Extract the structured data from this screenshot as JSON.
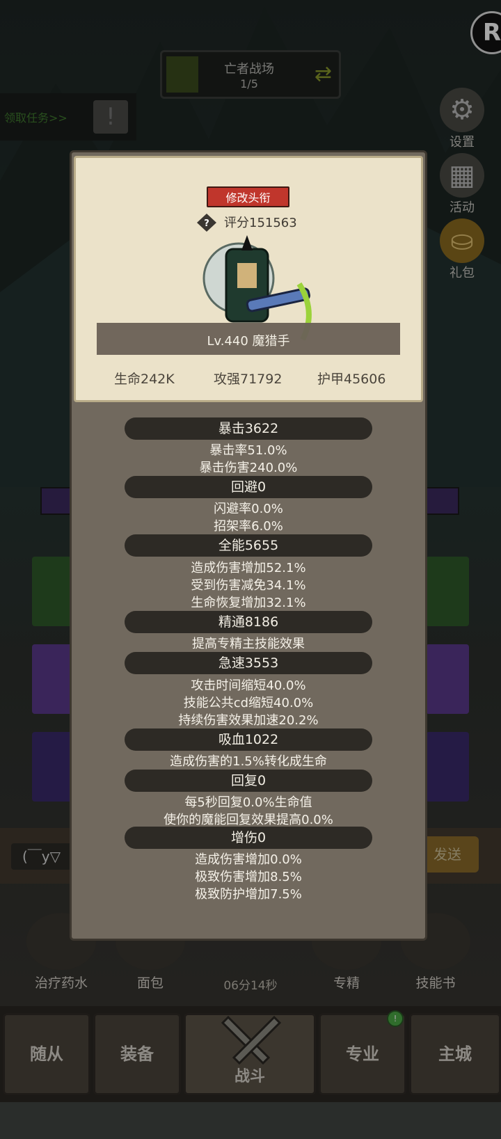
{
  "top": {
    "stage_name": "亡者战场",
    "stage_progress": "1/5"
  },
  "task": {
    "label": "领取任务>>",
    "icon": "exclamation-icon"
  },
  "side_buttons": [
    {
      "label": "设置",
      "icon": "gear-icon"
    },
    {
      "label": "活动",
      "icon": "calendar-icon"
    },
    {
      "label": "礼包",
      "icon": "gift-icon"
    }
  ],
  "panel": {
    "title_button": "修改头衔",
    "score": "评分151563",
    "hero_name": "Lv.440 魔猎手",
    "base_stats": [
      "生命242K",
      "攻强71792",
      "护甲45606"
    ],
    "stats": [
      {
        "header": "暴击3622",
        "lines": [
          "暴击率51.0%",
          "暴击伤害240.0%"
        ]
      },
      {
        "header": "回避0",
        "lines": [
          "闪避率0.0%",
          "招架率6.0%"
        ]
      },
      {
        "header": "全能5655",
        "lines": [
          "造成伤害增加52.1%",
          "受到伤害减免34.1%",
          "生命恢复增加32.1%"
        ]
      },
      {
        "header": "精通8186",
        "lines": [
          "提高专精主技能效果"
        ]
      },
      {
        "header": "急速3553",
        "lines": [
          "攻击时间缩短40.0%",
          "技能公共cd缩短40.0%",
          "持续伤害效果加速20.2%"
        ]
      },
      {
        "header": "吸血1022",
        "lines": [
          "造成伤害的1.5%转化成生命"
        ]
      },
      {
        "header": "回复0",
        "lines": [
          "每5秒回复0.0%生命值",
          "使你的魔能回复效果提高0.0%"
        ]
      },
      {
        "header": "增伤0",
        "lines": [
          "造成伤害增加0.0%",
          "极致伤害增加8.5%",
          "极致防护增加7.5%"
        ]
      }
    ]
  },
  "chat": {
    "input_text": "(￣y▽",
    "send_label": "发送"
  },
  "items": [
    "治疗药水",
    "面包",
    "专精",
    "技能书"
  ],
  "timer": "06分14秒",
  "nav": [
    "随从",
    "装备",
    "战斗",
    "专业",
    "主城"
  ],
  "colors": {
    "title_button": "#c0362c",
    "panel": "#71695e",
    "card": "#ebe2c9",
    "stat_pill": "#2d2a25"
  }
}
